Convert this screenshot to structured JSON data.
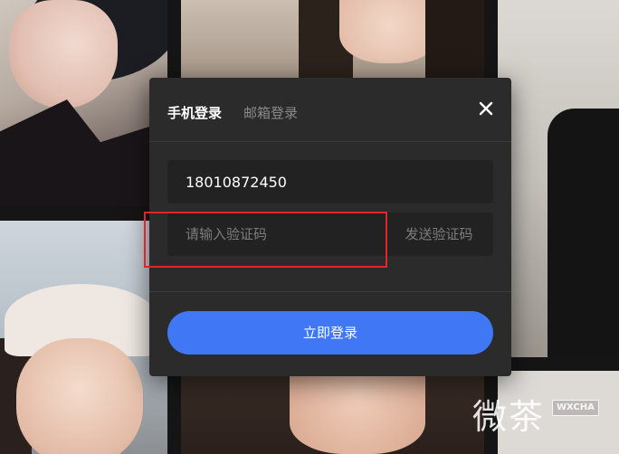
{
  "modal": {
    "tabs": [
      {
        "label": "手机登录",
        "active": true
      },
      {
        "label": "邮箱登录",
        "active": false
      }
    ],
    "phone_field": {
      "value": "18010872450"
    },
    "code_field": {
      "placeholder": "请输入验证码",
      "value": ""
    },
    "send_code_label": "发送验证码",
    "login_button_label": "立即登录"
  },
  "watermark": {
    "text": "微茶",
    "badge": "WXCHA"
  },
  "colors": {
    "accent": "#3f77f4",
    "highlight": "#e0262a",
    "modal_bg": "#2b2b2c",
    "field_bg": "#222223"
  },
  "icons": [
    "close-icon"
  ]
}
